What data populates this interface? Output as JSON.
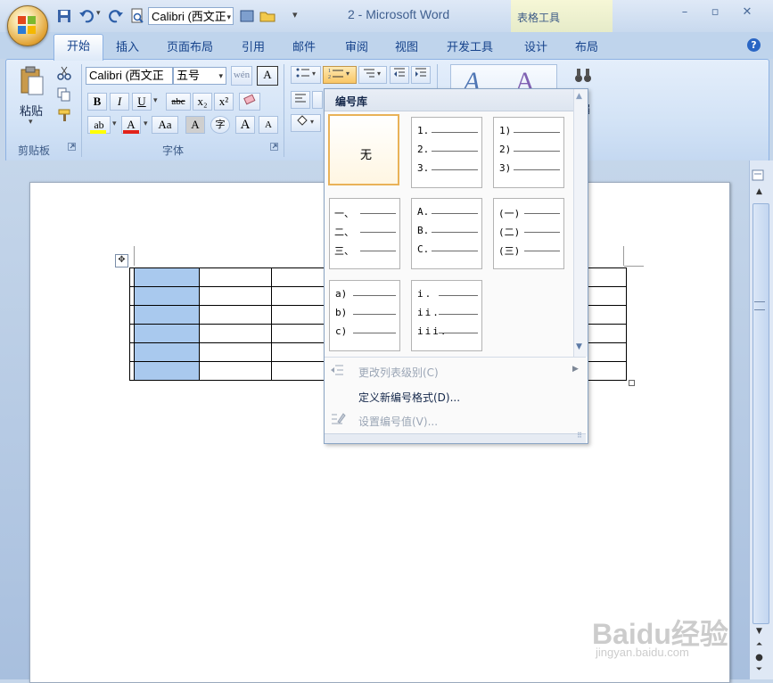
{
  "quick_access": {
    "font_name": "Calibri (西文正",
    "doc_title": "2 - Microsoft Word",
    "context_tab": "表格工具"
  },
  "tabs": [
    "开始",
    "插入",
    "页面布局",
    "引用",
    "邮件",
    "审阅",
    "视图",
    "开发工具",
    "设计",
    "布局"
  ],
  "ribbon": {
    "clipboard": {
      "paste_label": "粘贴",
      "group_label": "剪贴板"
    },
    "font": {
      "font_name": "Calibri (西文正",
      "font_size": "五号",
      "group_label": "字体",
      "buttons": {
        "bold": "B",
        "italic": "I",
        "underline": "U",
        "strike": "abc",
        "subscript": "x₂",
        "superscript": "x²",
        "font_color": "A",
        "change_case": "Aa",
        "char_shading": "A",
        "enclose": "字",
        "grow": "A",
        "shrink": "A"
      }
    },
    "right_partial_label": "编"
  },
  "numbering_dropdown": {
    "header": "编号库",
    "cells": [
      {
        "type": "none",
        "label": "无",
        "selected": true
      },
      {
        "type": "list",
        "prefixes": [
          "1.",
          "2.",
          "3."
        ]
      },
      {
        "type": "list",
        "prefixes": [
          "1)",
          "2)",
          "3)"
        ]
      },
      {
        "type": "list",
        "prefixes": [
          "一、",
          "二、",
          "三、"
        ]
      },
      {
        "type": "list",
        "prefixes": [
          "A.",
          "B.",
          "C."
        ]
      },
      {
        "type": "list",
        "prefixes": [
          "(一)",
          "(二)",
          "(三)"
        ]
      },
      {
        "type": "list",
        "prefixes": [
          "a)",
          "b)",
          "c)"
        ]
      },
      {
        "type": "list",
        "prefixes": [
          "i.",
          "ii.",
          "iii."
        ]
      }
    ],
    "menu": [
      {
        "label": "更改列表级别(C)",
        "enabled": false,
        "has_submenu": true
      },
      {
        "label": "定义新编号格式(D)...",
        "enabled": true,
        "has_submenu": false
      },
      {
        "label": "设置编号值(V)...",
        "enabled": false,
        "has_submenu": false
      }
    ]
  },
  "watermark": {
    "brand": "Baidu经验",
    "url": "jingyan.baidu.com"
  },
  "colors": {
    "accent": "#15428b",
    "selected_cell_border": "#e9b258",
    "table_highlight": "#a9c9ee"
  }
}
